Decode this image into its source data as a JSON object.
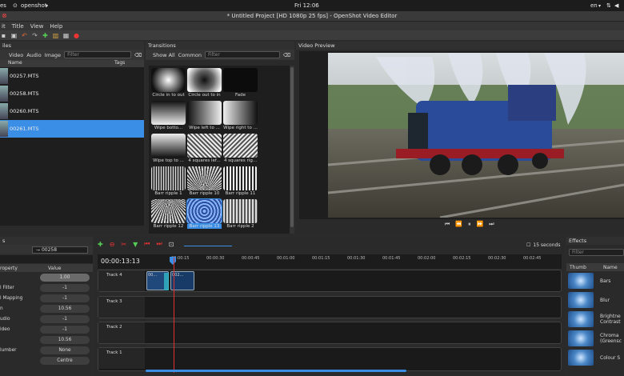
{
  "topbar": {
    "left": "es",
    "app": "openshot",
    "time": "Fri 12:06",
    "lang": "en"
  },
  "window": {
    "title": "* Untitled Project [HD 1080p 25 fps] - OpenShot Video Editor"
  },
  "menu": [
    "it",
    "Title",
    "View",
    "Help"
  ],
  "files": {
    "header": "iles",
    "filters": [
      "Video",
      "Audio",
      "Image"
    ],
    "filter_placeholder": "Filter",
    "columns": {
      "name": "Name",
      "tags": "Tags"
    },
    "items": [
      "00257.MTS",
      "00258.MTS",
      "00260.MTS",
      "00261.MTS"
    ],
    "selected_index": 3
  },
  "transitions": {
    "header": "Transitions",
    "tabs": [
      "Show All",
      "Common"
    ],
    "filter_placeholder": "Filter",
    "items": [
      "Circle in to out",
      "Circle out to in",
      "Fade",
      "Wipe botto...",
      "Wipe left to ...",
      "Wipe right to ...",
      "Wipe top to ...",
      "4 squares lef...",
      "4 squares rig...",
      "Barr ripple 1",
      "Barr ripple 10",
      "Barr ripple 11",
      "Barr ripple 12",
      "Barr ripple 13",
      "Barr ripple 2"
    ],
    "selected_index": 13
  },
  "preview": {
    "header": "Video Preview"
  },
  "properties": {
    "header": "s",
    "clip_selector": "00258",
    "columns": {
      "property": "roperty",
      "value": "Value"
    },
    "rows": [
      {
        "name": "",
        "value": "1.00"
      },
      {
        "name": "l Filter",
        "value": "-1"
      },
      {
        "name": "l Mapping",
        "value": "-1"
      },
      {
        "name": "n",
        "value": "10.56"
      },
      {
        "name": "udio",
        "value": "-1"
      },
      {
        "name": "ideo",
        "value": "-1"
      },
      {
        "name": "",
        "value": "10.56"
      },
      {
        "name": "lumber",
        "value": "None"
      },
      {
        "name": "",
        "value": "Centre"
      }
    ]
  },
  "timeline": {
    "current_time": "00:00:13:13",
    "zoom_label": "15 seconds",
    "ruler": [
      "00:00:15",
      "00:00:30",
      "00:00:45",
      "00:01:00",
      "00:01:15",
      "00:01:30",
      "00:01:45",
      "00:02:00",
      "00:02:15",
      "00:02:30",
      "00:02:45"
    ],
    "tracks": [
      "Track 4",
      "Track 3",
      "Track 2",
      "Track 1"
    ],
    "clips": [
      "00...",
      "002..."
    ]
  },
  "effects": {
    "header": "Effects",
    "filter_placeholder": "Filter",
    "columns": {
      "thumb": "Thumb",
      "name": "Name"
    },
    "items": [
      "Bars",
      "Blur",
      "Brightne Contrast",
      "Chroma (Greensc",
      "Colour S"
    ]
  },
  "colors": {
    "selection": "#3a8ee6",
    "playhead": "#e03030",
    "accent": "#1f3f7a"
  }
}
